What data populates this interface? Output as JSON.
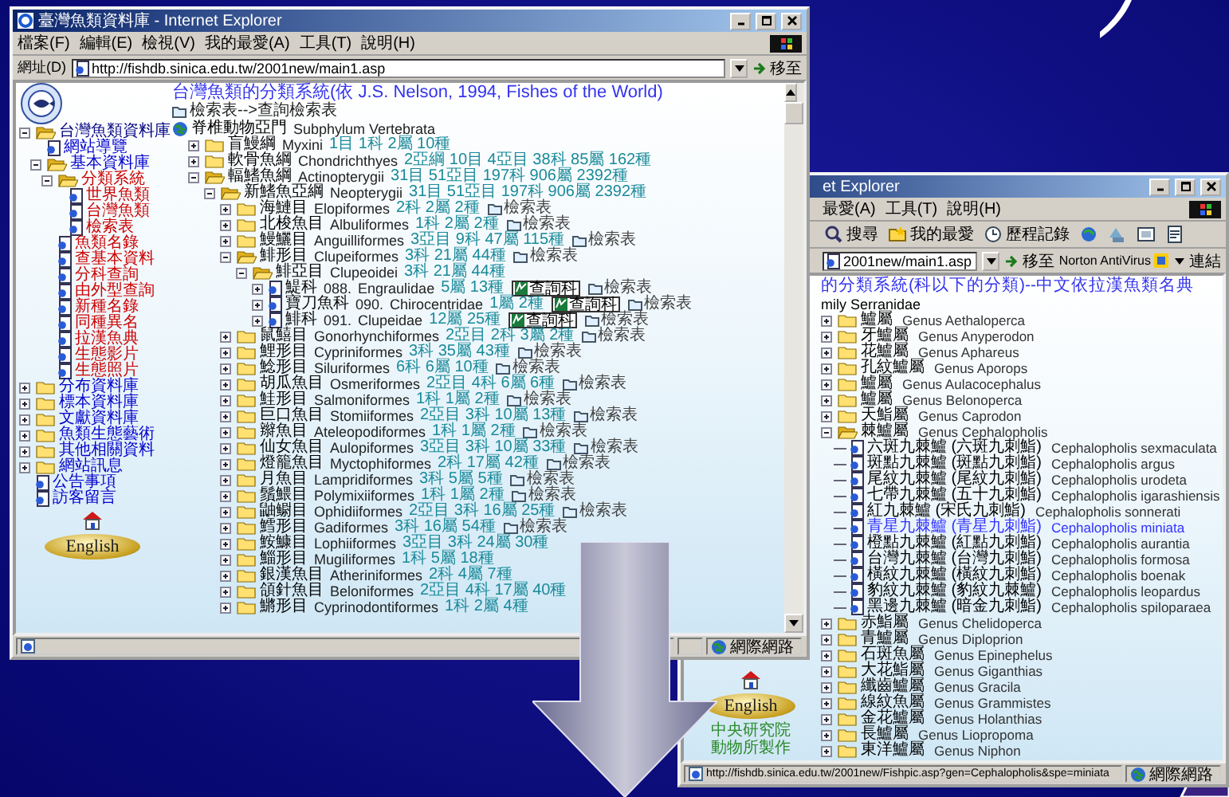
{
  "main_window": {
    "title": "臺灣魚類資料庫 - Internet Explorer",
    "menu": [
      "檔案(F)",
      "編輯(E)",
      "檢視(V)",
      "我的最愛(A)",
      "工具(T)",
      "說明(H)"
    ],
    "address_label": "網址(D)",
    "url": "http://fishdb.sinica.edu.tw/2001new/main1.asp",
    "go": "移至",
    "status": "網際網路",
    "sidebar": {
      "items": [
        {
          "label": "台灣魚類資料庫",
          "kind": "folder",
          "expanded": true,
          "color": "#000080",
          "children": [
            {
              "label": "網站導覽",
              "kind": "page",
              "color": "#0000cc"
            },
            {
              "label": "基本資料庫",
              "kind": "folder",
              "expanded": true,
              "color": "#0000cc",
              "children": [
                {
                  "label": "分類系統",
                  "kind": "folder",
                  "expanded": true,
                  "color": "#cc0000",
                  "children": [
                    {
                      "label": "世界魚類",
                      "kind": "page",
                      "color": "#cc0000"
                    },
                    {
                      "label": "台灣魚類",
                      "kind": "page",
                      "color": "#cc0000"
                    },
                    {
                      "label": "檢索表",
                      "kind": "page",
                      "color": "#cc0000"
                    }
                  ]
                },
                {
                  "label": "魚類名錄",
                  "kind": "page",
                  "color": "#cc0000"
                },
                {
                  "label": "查基本資料",
                  "kind": "page",
                  "color": "#cc0000"
                },
                {
                  "label": "分科查詢",
                  "kind": "page",
                  "color": "#cc0000"
                },
                {
                  "label": "由外型查詢",
                  "kind": "page",
                  "color": "#cc0000"
                },
                {
                  "label": "新種名錄",
                  "kind": "page",
                  "color": "#cc0000"
                },
                {
                  "label": "同種異名",
                  "kind": "page",
                  "color": "#cc0000"
                },
                {
                  "label": "拉漢魚典",
                  "kind": "page",
                  "color": "#cc0000"
                },
                {
                  "label": "生態影片",
                  "kind": "page",
                  "color": "#cc0000"
                },
                {
                  "label": "生態照片",
                  "kind": "page",
                  "color": "#cc0000"
                }
              ]
            }
          ]
        },
        {
          "label": "分布資料庫",
          "kind": "folder",
          "expanded": false,
          "color": "#0000cc"
        },
        {
          "label": "標本資料庫",
          "kind": "folder",
          "expanded": false,
          "color": "#0000cc"
        },
        {
          "label": "文獻資料庫",
          "kind": "folder",
          "expanded": false,
          "color": "#0000cc"
        },
        {
          "label": "魚類生態藝術",
          "kind": "folder",
          "expanded": false,
          "color": "#0000cc"
        },
        {
          "label": "其他相關資料",
          "kind": "folder",
          "expanded": false,
          "color": "#0000cc"
        },
        {
          "label": "網站訊息",
          "kind": "folder",
          "expanded": false,
          "color": "#0000cc"
        },
        {
          "label": "公告事項",
          "kind": "page",
          "color": "#0000cc"
        },
        {
          "label": "訪客留言",
          "kind": "page",
          "color": "#0000cc"
        }
      ],
      "english": "English"
    },
    "heading": "台灣魚類的分類系統(依 J.S. Nelson, 1994, Fishes of the World)",
    "heading_link": "檢索表-->查詢檢索表",
    "tree": [
      {
        "kind": "root",
        "name": "脊椎動物亞門",
        "latin": "Subphylum Vertebrata",
        "expanded": true,
        "children": [
          {
            "kind": "class",
            "name": "盲鰻綱",
            "latin": "Myxini",
            "counts": "1目 1科 2屬 10種",
            "expanded": false
          },
          {
            "kind": "class",
            "name": "軟骨魚綱",
            "latin": "Chondrichthyes",
            "counts": "2亞綱 10目 4亞目 38科 85屬 162種",
            "expanded": false
          },
          {
            "kind": "class",
            "name": "輻鰭魚綱",
            "latin": "Actinopterygii",
            "counts": "31目 51亞目 197科 906屬 2392種",
            "expanded": true,
            "children": [
              {
                "kind": "class",
                "name": "新鰭魚亞綱",
                "latin": "Neopterygii",
                "counts": "31目 51亞目 197科 906屬 2392種",
                "expanded": true,
                "children": [
                  {
                    "kind": "order",
                    "name": "海鰱目",
                    "latin": "Elopiformes",
                    "counts": "2科 2屬 2種",
                    "search": "檢索表",
                    "expanded": false
                  },
                  {
                    "kind": "order",
                    "name": "北梭魚目",
                    "latin": "Albuliformes",
                    "counts": "1科 2屬 2種",
                    "search": "檢索表",
                    "expanded": false
                  },
                  {
                    "kind": "order",
                    "name": "鰻鱺目",
                    "latin": "Anguilliformes",
                    "counts": "3亞目 9科 47屬 115種",
                    "search": "檢索表",
                    "expanded": false
                  },
                  {
                    "kind": "order",
                    "name": "鯡形目",
                    "latin": "Clupeiformes",
                    "counts": "3科 21屬 44種",
                    "search": "檢索表",
                    "expanded": true,
                    "children": [
                      {
                        "kind": "suborder",
                        "name": "鯡亞目",
                        "latin": "Clupeoidei",
                        "counts": "3科 21屬 44種",
                        "expanded": true,
                        "children": [
                          {
                            "kind": "family",
                            "name": "鯷科",
                            "number": "088.",
                            "latin": "Engraulidae",
                            "counts": "5屬 13種",
                            "query": "查詢科",
                            "search": "檢索表",
                            "expanded": false
                          },
                          {
                            "kind": "family",
                            "name": "寶刀魚科",
                            "number": "090.",
                            "latin": "Chirocentridae",
                            "counts": "1屬 2種",
                            "query": "查詢科",
                            "search": "檢索表",
                            "expanded": false
                          },
                          {
                            "kind": "family",
                            "name": "鯡科",
                            "number": "091.",
                            "latin": "Clupeidae",
                            "counts": "12屬 25種",
                            "query": "查詢科",
                            "search": "檢索表",
                            "expanded": false
                          }
                        ]
                      }
                    ]
                  },
                  {
                    "kind": "order",
                    "name": "鼠鱚目",
                    "latin": "Gonorhynchiformes",
                    "counts": "2亞目 2科 3屬 2種",
                    "search": "檢索表",
                    "expanded": false
                  },
                  {
                    "kind": "order",
                    "name": "鯉形目",
                    "latin": "Cypriniformes",
                    "counts": "3科 35屬 43種",
                    "search": "檢索表",
                    "expanded": false
                  },
                  {
                    "kind": "order",
                    "name": "鯰形目",
                    "latin": "Siluriformes",
                    "counts": "6科 6屬 10種",
                    "search": "檢索表",
                    "expanded": false
                  },
                  {
                    "kind": "order",
                    "name": "胡瓜魚目",
                    "latin": "Osmeriformes",
                    "counts": "2亞目 4科 6屬 6種",
                    "search": "檢索表",
                    "expanded": false
                  },
                  {
                    "kind": "order",
                    "name": "鮭形目",
                    "latin": "Salmoniformes",
                    "counts": "1科 1屬 2種",
                    "search": "檢索表",
                    "expanded": false
                  },
                  {
                    "kind": "order",
                    "name": "巨口魚目",
                    "latin": "Stomiiformes",
                    "counts": "2亞目 3科 10屬 13種",
                    "search": "檢索表",
                    "expanded": false
                  },
                  {
                    "kind": "order",
                    "name": "辮魚目",
                    "latin": "Ateleopodiformes",
                    "counts": "1科 1屬 2種",
                    "search": "檢索表",
                    "expanded": false
                  },
                  {
                    "kind": "order",
                    "name": "仙女魚目",
                    "latin": "Aulopiformes",
                    "counts": "3亞目 3科 10屬 33種",
                    "search": "檢索表",
                    "expanded": false
                  },
                  {
                    "kind": "order",
                    "name": "燈籠魚目",
                    "latin": "Myctophiformes",
                    "counts": "2科 17屬 42種",
                    "search": "檢索表",
                    "expanded": false
                  },
                  {
                    "kind": "order",
                    "name": "月魚目",
                    "latin": "Lampridiformes",
                    "counts": "3科 5屬 5種",
                    "search": "檢索表",
                    "expanded": false
                  },
                  {
                    "kind": "order",
                    "name": "鬚鰃目",
                    "latin": "Polymixiiformes",
                    "counts": "1科 1屬 2種",
                    "search": "檢索表",
                    "expanded": false
                  },
                  {
                    "kind": "order",
                    "name": "鼬鳚目",
                    "latin": "Ophidiiformes",
                    "counts": "2亞目 3科 16屬 25種",
                    "search": "檢索表",
                    "expanded": false
                  },
                  {
                    "kind": "order",
                    "name": "鱈形目",
                    "latin": "Gadiformes",
                    "counts": "3科 16屬 54種",
                    "search": "檢索表",
                    "expanded": false
                  },
                  {
                    "kind": "order",
                    "name": "鮟鱇目",
                    "latin": "Lophiiformes",
                    "counts": "3亞目 3科 24屬 30種",
                    "expanded": false
                  },
                  {
                    "kind": "order",
                    "name": "鯔形目",
                    "latin": "Mugiliformes",
                    "counts": "1科 5屬 18種",
                    "expanded": false
                  },
                  {
                    "kind": "order",
                    "name": "銀漢魚目",
                    "latin": "Atheriniformes",
                    "counts": "2科 4屬 7種",
                    "expanded": false
                  },
                  {
                    "kind": "order",
                    "name": "頜針魚目",
                    "latin": "Beloniformes",
                    "counts": "2亞目 4科 17屬 40種",
                    "expanded": false
                  },
                  {
                    "kind": "order",
                    "name": "鱂形目",
                    "latin": "Cyprinodontiformes",
                    "counts": "1科 2屬 4種",
                    "expanded": false
                  }
                ]
              }
            ]
          }
        ]
      }
    ]
  },
  "second_window": {
    "title": "et Explorer",
    "menu": [
      "最愛(A)",
      "工具(T)",
      "說明(H)"
    ],
    "toolbar": [
      "搜尋",
      "我的最愛",
      "歷程記錄"
    ],
    "url": "2001new/main1.asp",
    "go": "移至",
    "antivirus": "Norton AntiVirus",
    "links": "連結",
    "heading": "的分類系統(科以下的分類)--中文依拉漢魚類名典",
    "family": "mily Serranidae",
    "genera": [
      {
        "name": "鱸屬",
        "latin": "Genus Aethaloperca",
        "expanded": false
      },
      {
        "name": "牙鱸屬",
        "latin": "Genus Anyperodon",
        "expanded": false
      },
      {
        "name": "花鱸屬",
        "latin": "Genus Aphareus",
        "expanded": false
      },
      {
        "name": "孔紋鱸屬",
        "latin": "Genus Aporops",
        "expanded": false
      },
      {
        "name": "鱸屬",
        "latin": "Genus Aulacocephalus",
        "expanded": false
      },
      {
        "name": "鱸屬",
        "latin": "Genus Belonoperca",
        "expanded": false
      },
      {
        "name": "天鮨屬",
        "latin": "Genus Caprodon",
        "expanded": false
      },
      {
        "name": "棘鱸屬",
        "latin": "Genus Cephalopholis",
        "expanded": true,
        "children": [
          {
            "name": "六斑九棘鱸 (六斑九刺鮨)",
            "latin": "Cephalopholis sexmaculata",
            "selected": false
          },
          {
            "name": "斑點九棘鱸 (斑點九刺鮨)",
            "latin": "Cephalopholis argus",
            "selected": false
          },
          {
            "name": "尾紋九棘鱸 (尾紋九刺鮨)",
            "latin": "Cephalopholis urodeta",
            "selected": false
          },
          {
            "name": "七帶九棘鱸 (五十九刺鮨)",
            "latin": "Cephalopholis igarashiensis",
            "selected": false
          },
          {
            "name": "紅九棘鱸 (宋氏九刺鮨)",
            "latin": "Cephalopholis sonnerati",
            "selected": false
          },
          {
            "name": "青星九棘鱸 (青星九刺鮨)",
            "latin": "Cephalopholis miniata",
            "selected": true
          },
          {
            "name": "橙點九棘鱸 (紅點九刺鮨)",
            "latin": "Cephalopholis aurantia",
            "selected": false
          },
          {
            "name": "台灣九棘鱸 (台灣九刺鮨)",
            "latin": "Cephalopholis formosa",
            "selected": false
          },
          {
            "name": "橫紋九棘鱸 (橫紋九刺鮨)",
            "latin": "Cephalopholis boenak",
            "selected": false
          },
          {
            "name": "豹紋九棘鱸 (豹紋九棘鱸)",
            "latin": "Cephalopholis leopardus",
            "selected": false
          },
          {
            "name": "黑邊九棘鱸 (暗金九刺鮨)",
            "latin": "Cephalopholis spiloparaea",
            "selected": false
          }
        ]
      },
      {
        "name": "赤鮨屬",
        "latin": "Genus Chelidoperca",
        "expanded": false
      },
      {
        "name": "青鱸屬",
        "latin": "Genus Diploprion",
        "expanded": false
      },
      {
        "name": "石斑魚屬",
        "latin": "Genus Epinephelus",
        "expanded": false
      },
      {
        "name": "大花鮨屬",
        "latin": "Genus Giganthias",
        "expanded": false
      },
      {
        "name": "纖齒鱸屬",
        "latin": "Genus Gracila",
        "expanded": false
      },
      {
        "name": "線紋魚屬",
        "latin": "Genus Grammistes",
        "expanded": false
      },
      {
        "name": "金花鱸屬",
        "latin": "Genus Holanthias",
        "expanded": false
      },
      {
        "name": "長鱸屬",
        "latin": "Genus Liopropoma",
        "expanded": false
      },
      {
        "name": "東洋鱸屬",
        "latin": "Genus Niphon",
        "expanded": false
      }
    ],
    "english": "English",
    "credit": "中央研究院動物所製作",
    "status_url": "http://fishdb.sinica.edu.tw/2001new/Fishpic.asp?gen=Cephalopholis&spe=miniata",
    "status": "網際網路"
  }
}
